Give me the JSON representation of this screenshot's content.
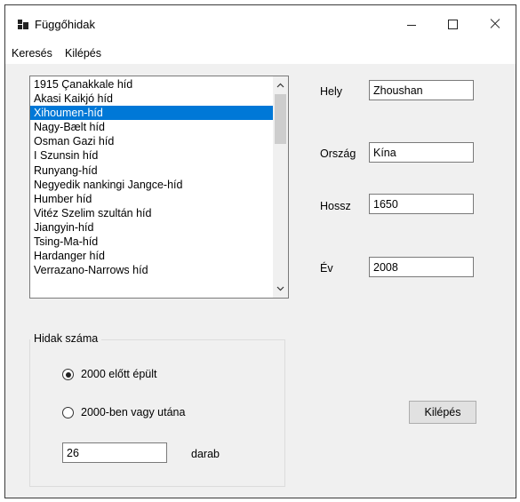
{
  "window": {
    "title": "Függőhidak"
  },
  "menu": {
    "items": [
      "Keresés",
      "Kilépés"
    ]
  },
  "bridges": {
    "items": [
      "1915 Çanakkale híd",
      "Akasi Kaikjó híd",
      "Xihoumen-híd",
      "Nagy-Bælt híd",
      "Osman Gazi híd",
      "I Szunsin híd",
      "Runyang-híd",
      "Negyedik nankingi Jangce-híd",
      "Humber híd",
      "Vitéz Szelim szultán híd",
      "Jiangyin-híd",
      "Tsing-Ma-híd",
      "Hardanger híd",
      "Verrazano-Narrows híd"
    ],
    "selected": "Xihoumen-híd"
  },
  "details": {
    "location_label": "Hely",
    "location_value": "Zhoushan",
    "country_label": "Ország",
    "country_value": "Kína",
    "length_label": "Hossz",
    "length_value": "1650",
    "year_label": "Év",
    "year_value": "2008"
  },
  "count_group": {
    "caption": "Hidak száma",
    "option_before": "2000 előtt épült",
    "option_after": "2000-ben vagy utána",
    "selected_option": "2000 előtt épült",
    "count_value": "26",
    "unit": "darab"
  },
  "exit_button": {
    "label": "Kilépés"
  },
  "colors": {
    "selection": "#0078d7",
    "form_background": "#f0f0f0"
  }
}
